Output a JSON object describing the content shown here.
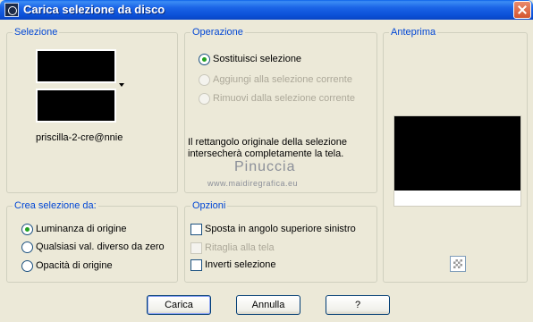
{
  "window": {
    "title": "Carica selezione da disco"
  },
  "selezione": {
    "legend": "Selezione",
    "filename": "priscilla-2-cre@nnie"
  },
  "operazione": {
    "legend": "Operazione",
    "options": [
      {
        "label": "Sostituisci selezione",
        "checked": true,
        "enabled": true
      },
      {
        "label": "Aggiungi alla selezione corrente",
        "checked": false,
        "enabled": false
      },
      {
        "label": "Rimuovi dalla selezione corrente",
        "checked": false,
        "enabled": false
      }
    ],
    "info_line1": "Il rettangolo originale della selezione",
    "info_line2": "intersecherà completamente la tela."
  },
  "anteprima": {
    "legend": "Anteprima"
  },
  "watermark": {
    "line1": "Pinuccia",
    "line2": "www.maidiregrafica.eu"
  },
  "crea": {
    "legend": "Crea selezione da:",
    "options": [
      {
        "label": "Luminanza di origine",
        "checked": true
      },
      {
        "label": "Qualsiasi val. diverso da zero",
        "checked": false
      },
      {
        "label": "Opacità di origine",
        "checked": false
      }
    ]
  },
  "opzioni": {
    "legend": "Opzioni",
    "items": [
      {
        "label": "Sposta in angolo superiore sinistro",
        "checked": false,
        "enabled": true
      },
      {
        "label": "Ritaglia alla tela",
        "checked": false,
        "enabled": false
      },
      {
        "label": "Inverti selezione",
        "checked": false,
        "enabled": true
      }
    ]
  },
  "buttons": {
    "load": "Carica",
    "cancel": "Annulla",
    "help": "?"
  }
}
